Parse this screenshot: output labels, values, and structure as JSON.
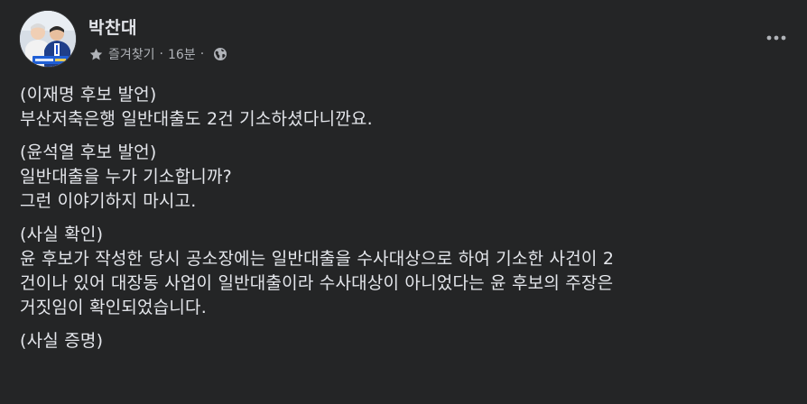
{
  "author": {
    "name": "박찬대",
    "avatar_icon": "profile-photo-icon"
  },
  "meta": {
    "favorites_label": "즐겨찾기",
    "separator": "·",
    "time": "16분",
    "audience_icon": "globe-icon"
  },
  "more_icon": "more-options-icon",
  "paragraphs": [
    {
      "lines": [
        "(이재명 후보 발언)",
        "부산저축은행 일반대출도 2건 기소하셨다니깐요."
      ]
    },
    {
      "lines": [
        "(윤석열 후보 발언)",
        "일반대출을 누가 기소합니까?",
        "그런 이야기하지 마시고."
      ]
    },
    {
      "lines": [
        "(사실 확인)",
        "윤 후보가 작성한 당시 공소장에는 일반대출을 수사대상으로 하여 기소한 사건이 2",
        "건이나 있어 대장동 사업이 일반대출이라 수사대상이 아니었다는 윤 후보의 주장은",
        "거짓임이 확인되었습니다."
      ]
    },
    {
      "lines": [
        "(사실 증명)"
      ]
    }
  ],
  "colors": {
    "background": "#242526",
    "primary_text": "#e4e6eb",
    "secondary_text": "#b0b3b8"
  }
}
